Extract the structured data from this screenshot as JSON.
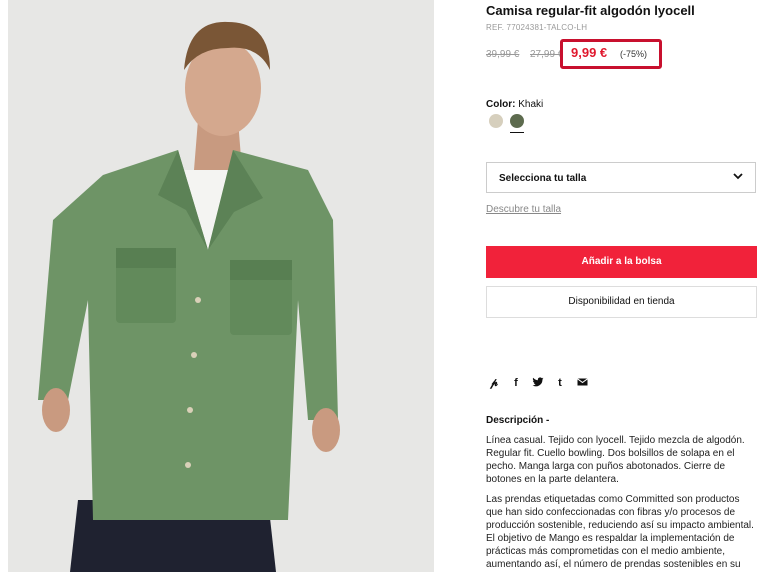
{
  "product": {
    "title": "Camisa regular-fit algodón lyocell",
    "ref": "REF. 77024381-TALCO-LH",
    "old_price_1": "39,99 €",
    "old_price_2": "27,99 €",
    "price": "9,99 €",
    "discount": "(-75%)",
    "color_label": "Color:",
    "color_value": "Khaki",
    "swatches": [
      {
        "name": "beige-swatch",
        "color": "#d6cfbd"
      },
      {
        "name": "khaki-swatch",
        "color": "#5d6b4e"
      }
    ]
  },
  "size": {
    "label": "Selecciona tu talla"
  },
  "guide_link": "Descubre tu talla",
  "buttons": {
    "add_to_bag": "Añadir a la bolsa",
    "store_availability": "Disponibilidad en tienda"
  },
  "share_icons": [
    "pinterest-icon",
    "facebook-icon",
    "twitter-icon",
    "tumblr-icon",
    "email-icon"
  ],
  "description": {
    "title": "Descripción -",
    "paragraph_1": "Línea casual. Tejido con lyocell. Tejido mezcla de algodón. Regular fit. Cuello bowling. Dos bolsillos de solapa en el pecho. Manga larga con puños abotonados. Cierre de botones en la parte delantera.",
    "paragraph_2": "Las prendas etiquetadas como Committed son productos que han sido confeccionadas con fibras y/o procesos de producción sostenible, reduciendo así su impacto ambiental. El objetivo de Mango es respaldar la implementación de prácticas más comprometidas con el medio ambiente, aumentando así, el número de prendas sostenibles en su"
  },
  "colors": {
    "accent_red": "#f1223a",
    "highlight_border": "#c8102e"
  }
}
